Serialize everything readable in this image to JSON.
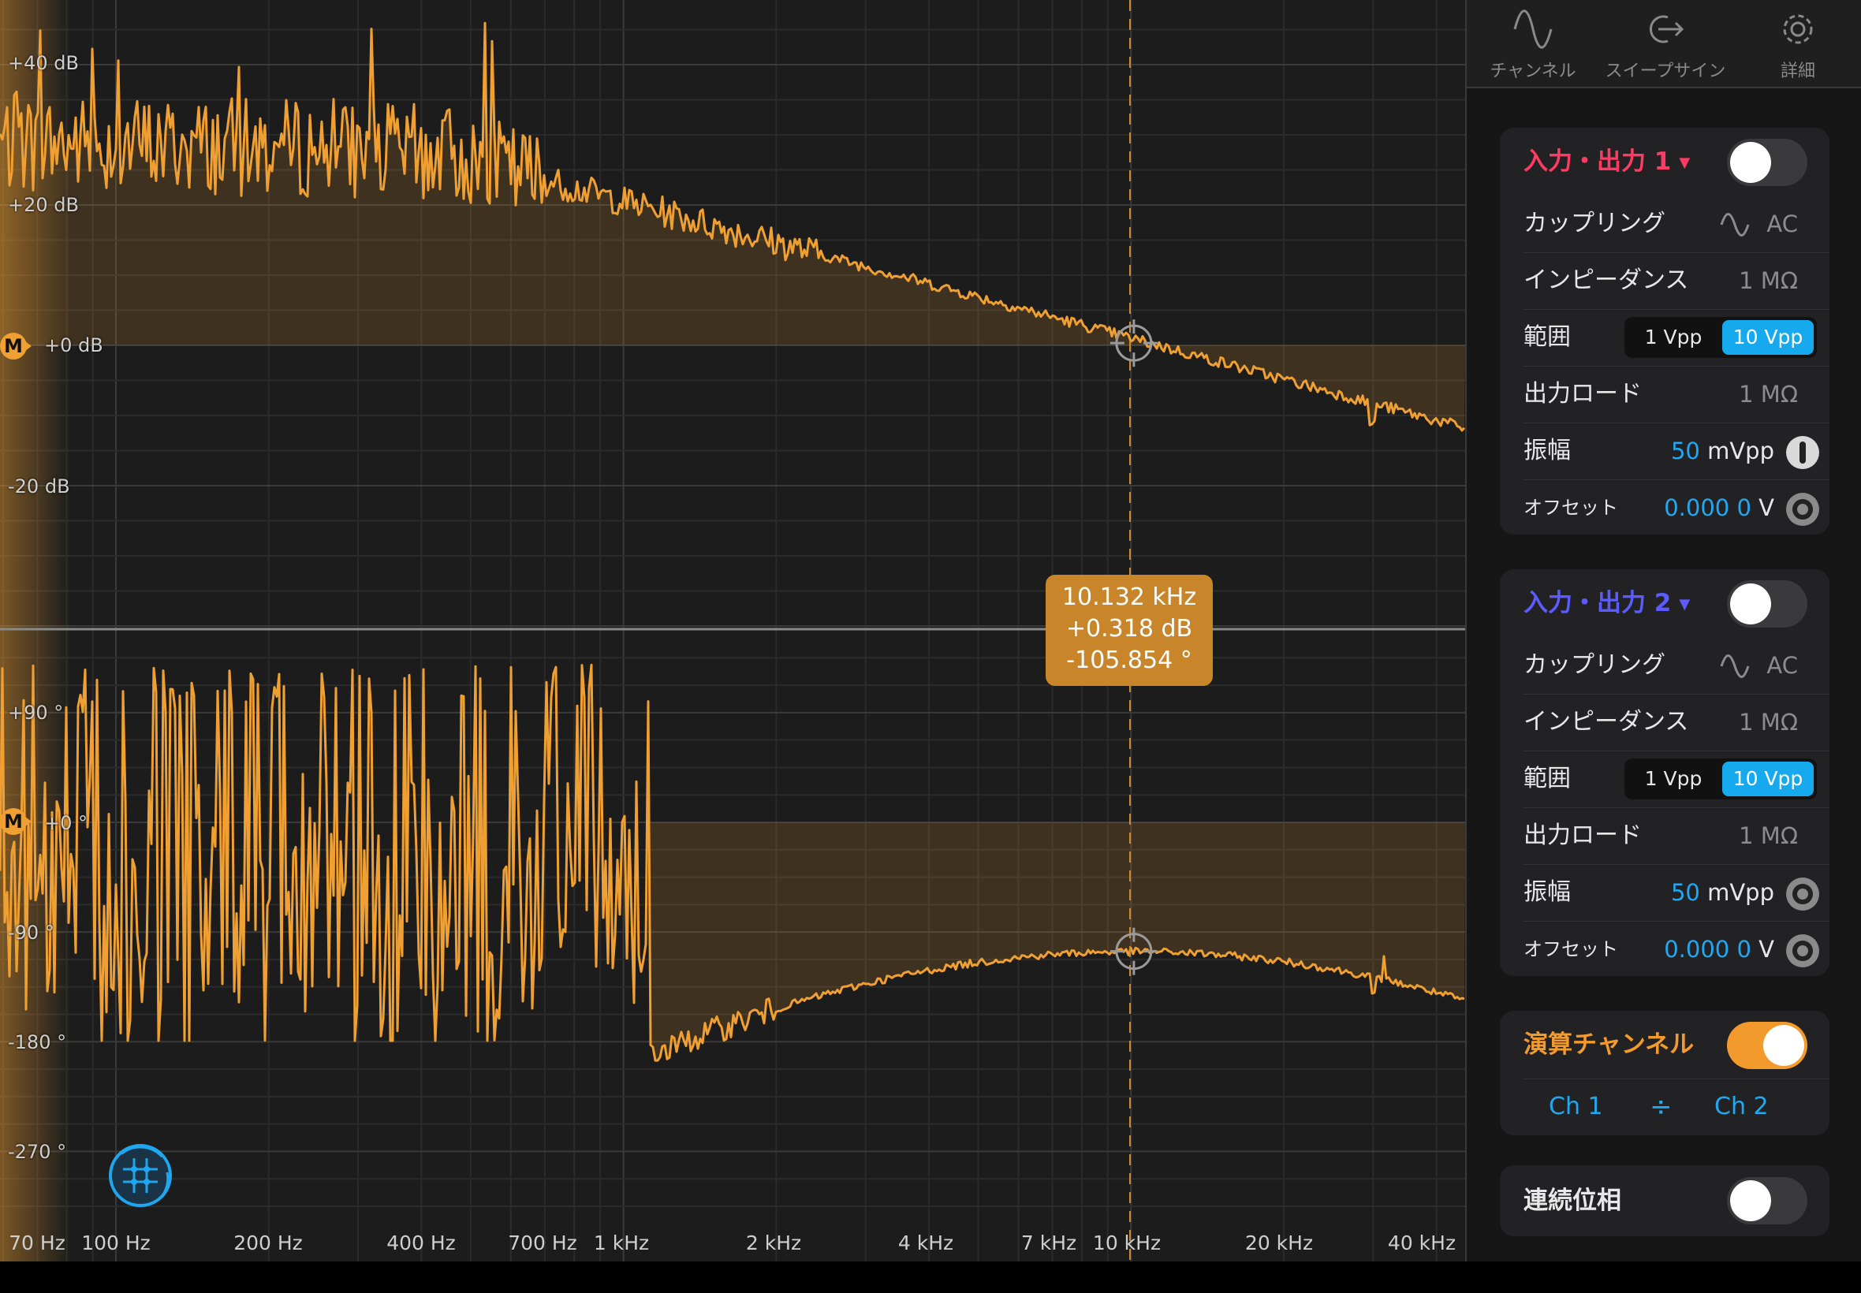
{
  "plot": {
    "magnitude_labels": [
      "+40 dB",
      "+20 dB",
      "+0 dB",
      "-20 dB"
    ],
    "phase_labels": [
      "+90 °",
      "+0 °",
      "-90 °",
      "-180 °",
      "-270 °"
    ],
    "frequency_labels": [
      "70 Hz",
      "100 Hz",
      "200 Hz",
      "400 Hz",
      "700 Hz",
      "1 kHz",
      "2 kHz",
      "4 kHz",
      "7 kHz",
      "10 kHz",
      "20 kHz",
      "40 kHz"
    ],
    "marker_letter": "M",
    "cursor_readout": {
      "frequency": "10.132 kHz",
      "gain": "+0.318 dB",
      "phase": "-105.854 °"
    },
    "trace_color": "#f0a032"
  },
  "tabs": [
    {
      "label": "チャンネル",
      "icon": "sine-wave-icon"
    },
    {
      "label": "スイープサイン",
      "icon": "sweep-export-icon"
    },
    {
      "label": "詳細",
      "icon": "gear-icon"
    }
  ],
  "channel1": {
    "title": "入力・出力 1",
    "title_color": "#ff3b63",
    "enabled": false,
    "coupling_label": "カップリング",
    "coupling_value": "AC",
    "impedance_label": "インピーダンス",
    "impedance_value": "1 MΩ",
    "range_label": "範囲",
    "range_options": [
      "1 Vpp",
      "10 Vpp"
    ],
    "range_selected": "10 Vpp",
    "load_label": "出力ロード",
    "load_value": "1 MΩ",
    "amplitude_label": "振幅",
    "amplitude_value": "50",
    "amplitude_unit": "mVpp",
    "offset_label": "オフセット",
    "offset_value": "0.000 0",
    "offset_unit": "V"
  },
  "channel2": {
    "title": "入力・出力 2",
    "title_color": "#5b5bff",
    "enabled": false,
    "coupling_label": "カップリング",
    "coupling_value": "AC",
    "impedance_label": "インピーダンス",
    "impedance_value": "1 MΩ",
    "range_label": "範囲",
    "range_options": [
      "1 Vpp",
      "10 Vpp"
    ],
    "range_selected": "10 Vpp",
    "load_label": "出力ロード",
    "load_value": "1 MΩ",
    "amplitude_label": "振幅",
    "amplitude_value": "50",
    "amplitude_unit": "mVpp",
    "offset_label": "オフセット",
    "offset_value": "0.000 0",
    "offset_unit": "V"
  },
  "math": {
    "title": "演算チャンネル",
    "enabled": true,
    "operand_a": "Ch 1",
    "operator": "÷",
    "operand_b": "Ch 2"
  },
  "continuous_phase": {
    "label": "連続位相",
    "enabled": false
  }
}
